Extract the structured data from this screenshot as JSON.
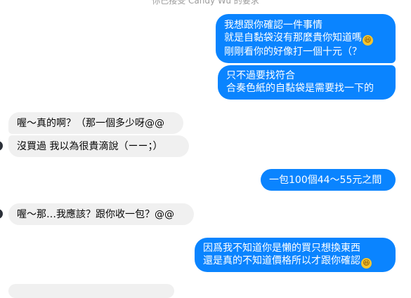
{
  "system_notice": "你已接受 Candy Wu 的要求",
  "messages": [
    {
      "side": "out",
      "lines": [
        "我想跟你確認一件事情",
        "就是自黏袋沒有那麼貴你知道嗎",
        "剛剛看你的好像打一個十元（？"
      ],
      "emoji_after_line": 1
    },
    {
      "side": "out",
      "lines": [
        "只不過要找符合",
        "合奏色紙的自黏袋是需要找一下的"
      ]
    },
    {
      "side": "in",
      "lines": [
        "喔～真的啊？（那一個多少呀@@"
      ]
    },
    {
      "side": "in",
      "lines": [
        "沒買過 我以為很貴滴說（ーー；）"
      ]
    },
    {
      "side": "out",
      "lines": [
        "一包100個44～55元之間"
      ]
    },
    {
      "side": "in",
      "lines": [
        "喔～那…我應該？跟你收一包？@@"
      ]
    },
    {
      "side": "out",
      "lines": [
        "因爲我不知道你是懶的買只想換東西",
        "還是真的不知道價格所以才跟你確認"
      ],
      "emoji_after_line": 1
    }
  ],
  "emoji": "laughing-face-icon",
  "colors": {
    "outgoing": "#0a84ff",
    "incoming": "#f0f0f0",
    "avatar": "#2b2f38"
  }
}
